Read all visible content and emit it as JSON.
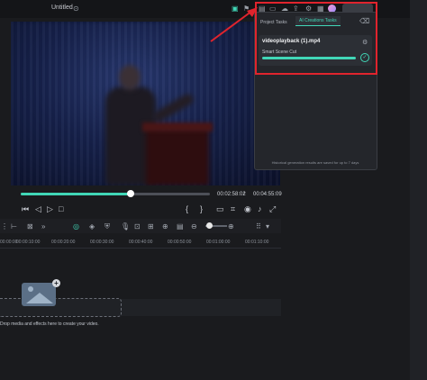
{
  "window": {
    "title": "Untitled"
  },
  "preview": {
    "current_time": "00:02:58:02",
    "total_time": "00:04:55:09",
    "progress": 0.58
  },
  "timeline": {
    "ruler": [
      "00:00:00",
      "00:00:10:00",
      "00:00:20:00",
      "00:00:30:00",
      "00:00:40:00",
      "00:00:50:00",
      "00:01:00:00",
      "00:01:10:00"
    ],
    "drop_text": "Drop media and effects here to create your video."
  },
  "task_panel": {
    "tabs": [
      {
        "label": "Project Tasks",
        "active": false
      },
      {
        "label": "AI Creations Tasks",
        "active": true
      }
    ],
    "task": {
      "name": "videoplayback (1).mp4",
      "subtitle": "Smart Scene Cut",
      "progress": 1.0,
      "status": "completed"
    },
    "footer_note": "Historical generation results are saved for up to 7 days"
  },
  "colors": {
    "accent": "#41d7b7",
    "annotation": "#e0242d",
    "background": "#1a1b1e"
  }
}
